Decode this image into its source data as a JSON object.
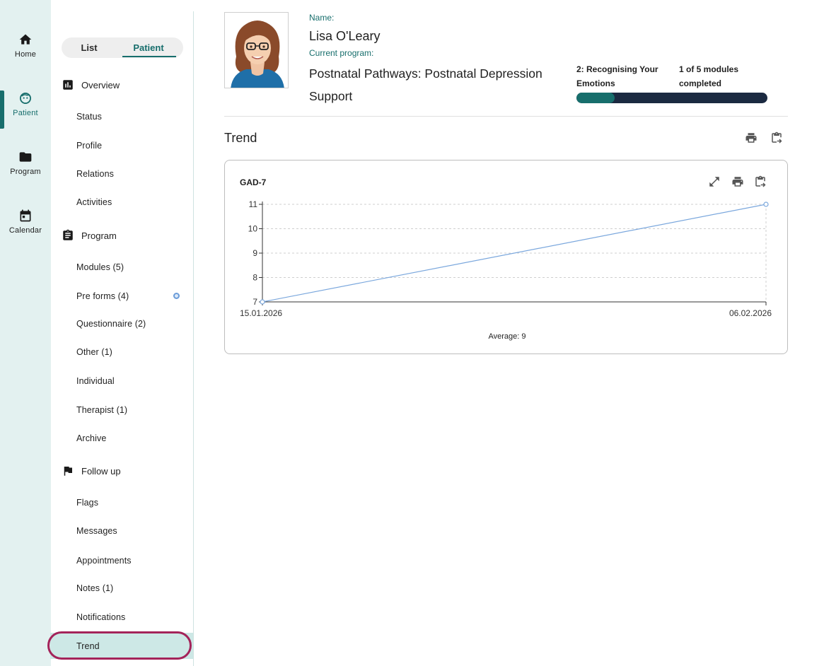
{
  "rail": {
    "items": [
      {
        "label": "Home",
        "icon": "home-icon"
      },
      {
        "label": "Patient",
        "icon": "patient-icon"
      },
      {
        "label": "Program",
        "icon": "folder-icon"
      },
      {
        "label": "Calendar",
        "icon": "calendar-icon"
      }
    ],
    "active": "Patient"
  },
  "toggle": {
    "list": "List",
    "patient": "Patient",
    "selected": "Patient"
  },
  "sidebar": {
    "overview": {
      "label": "Overview",
      "items": [
        "Status",
        "Profile",
        "Relations",
        "Activities"
      ]
    },
    "program": {
      "label": "Program",
      "items": [
        "Modules (5)",
        "Pre forms (4)",
        "Questionnaire (2)",
        "Other (1)",
        "Individual",
        "Therapist (1)",
        "Archive"
      ]
    },
    "followup": {
      "label": "Follow up",
      "items": [
        "Flags",
        "Messages",
        "Appointments",
        "Notes (1)",
        "Notifications",
        "Trend"
      ]
    },
    "selected": "Trend"
  },
  "header": {
    "name_label": "Name:",
    "name": "Lisa O'Leary",
    "program_label": "Current program:",
    "program": "Postnatal Pathways: Postnatal Depression Support",
    "module": "2: Recognising Your Emotions",
    "module_count": "1 of 5 modules completed",
    "progress": 0.2
  },
  "trend": {
    "title": "Trend"
  },
  "card": {
    "title": "GAD-7",
    "average": "Average: 9"
  },
  "chart_data": {
    "type": "line",
    "title": "GAD-7",
    "x": [
      "15.01.2026",
      "06.02.2026"
    ],
    "series": [
      {
        "values": [
          7,
          11
        ]
      }
    ],
    "ylim": [
      7,
      11
    ],
    "yticks": [
      7,
      8,
      9,
      10,
      11
    ],
    "grid": true,
    "annotation": "Average: 9"
  },
  "colors": {
    "accent": "#176e6c",
    "rail_bg": "#e3f1f0",
    "progress_track": "#1b2a41",
    "line": "#7aa7dd",
    "highlight_ring": "#a4235a"
  }
}
